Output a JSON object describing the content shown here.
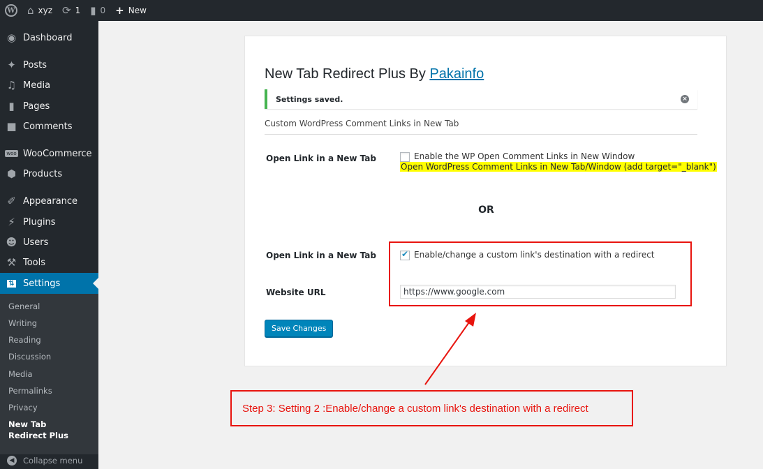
{
  "adminbar": {
    "site_name": "xyz",
    "updates_count": "1",
    "comments_count": "0",
    "new_label": "New"
  },
  "sidebar": {
    "items": [
      {
        "label": "Dashboard",
        "icon": "dashboard-icon"
      },
      {
        "label": "Posts",
        "icon": "pushpin-icon"
      },
      {
        "label": "Media",
        "icon": "media-icon"
      },
      {
        "label": "Pages",
        "icon": "pages-icon"
      },
      {
        "label": "Comments",
        "icon": "comment-icon"
      },
      {
        "label": "WooCommerce",
        "icon": "woocommerce-icon"
      },
      {
        "label": "Products",
        "icon": "box-icon"
      },
      {
        "label": "Appearance",
        "icon": "brush-icon"
      },
      {
        "label": "Plugins",
        "icon": "plug-icon"
      },
      {
        "label": "Users",
        "icon": "user-icon"
      },
      {
        "label": "Tools",
        "icon": "wrench-icon"
      },
      {
        "label": "Settings",
        "icon": "settings-icon"
      }
    ],
    "submenu": [
      "General",
      "Writing",
      "Reading",
      "Discussion",
      "Media",
      "Permalinks",
      "Privacy",
      "New Tab Redirect Plus"
    ],
    "collapse_label": "Collapse menu"
  },
  "panel": {
    "title_prefix": "New Tab Redirect Plus By ",
    "title_link": "Pakainfo",
    "notice": "Settings saved.",
    "section_desc": "Custom WordPress Comment Links in New Tab",
    "row1_label": "Open Link in a New Tab",
    "row1_checkbox": "Enable the WP Open Comment Links in New Window",
    "row1_checked": false,
    "row1_note": "Open WordPress Comment Links in New Tab/Window (add target=\"_blank\")",
    "or_label": "OR",
    "row2_label": "Open Link in a New Tab",
    "row2_checkbox": "Enable/change a custom link's destination with a redirect",
    "row2_checked": true,
    "url_label": "Website URL",
    "url_value": "https://www.google.com",
    "save_label": "Save Changes"
  },
  "annotation": {
    "step_text": "Step 3: Setting 2 :Enable/change a custom link's destination with a redirect",
    "color": "#e8140e"
  },
  "colors": {
    "admin_dark": "#23282d",
    "accent": "#0073aa",
    "success": "#46b450",
    "highlight": "#ffff00"
  }
}
